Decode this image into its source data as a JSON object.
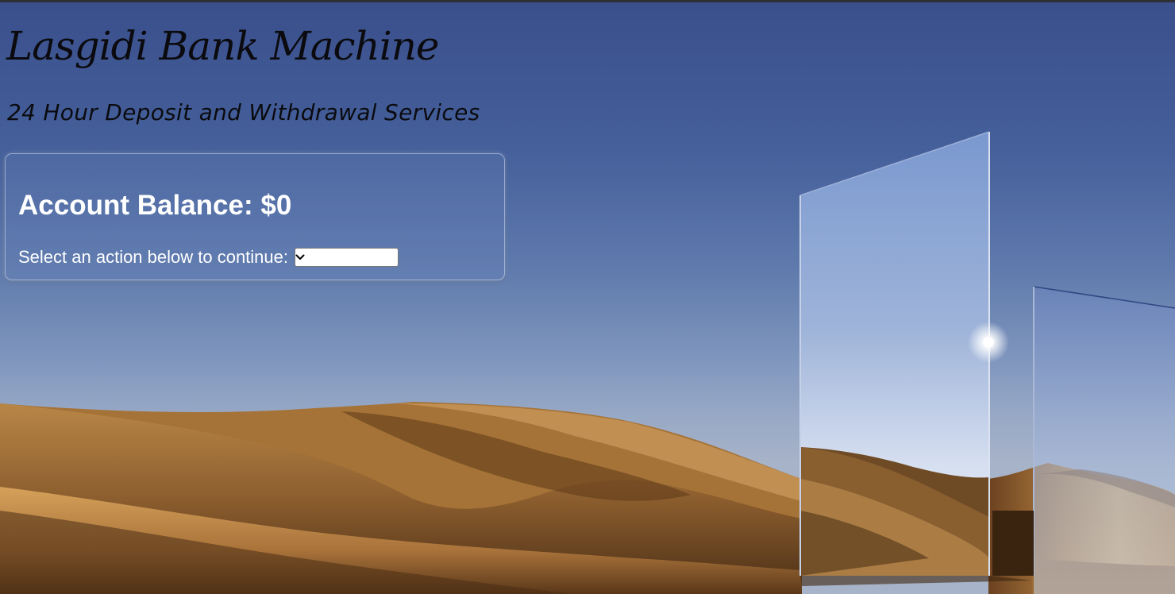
{
  "header": {
    "title": "Lasgidi Bank Machine",
    "subtitle": "24 Hour Deposit and Withdrawal Services"
  },
  "account": {
    "balance_label": "Account Balance: ",
    "balance_value": "$0"
  },
  "action": {
    "prompt": "Select an action below to continue: ",
    "selected_value": "",
    "icon": "chevron-down-icon"
  },
  "colors": {
    "text_dark": "#0b0b0f",
    "text_light": "#ffffff",
    "sky_top": "#3a4f8c",
    "sand": "#c8914f"
  }
}
